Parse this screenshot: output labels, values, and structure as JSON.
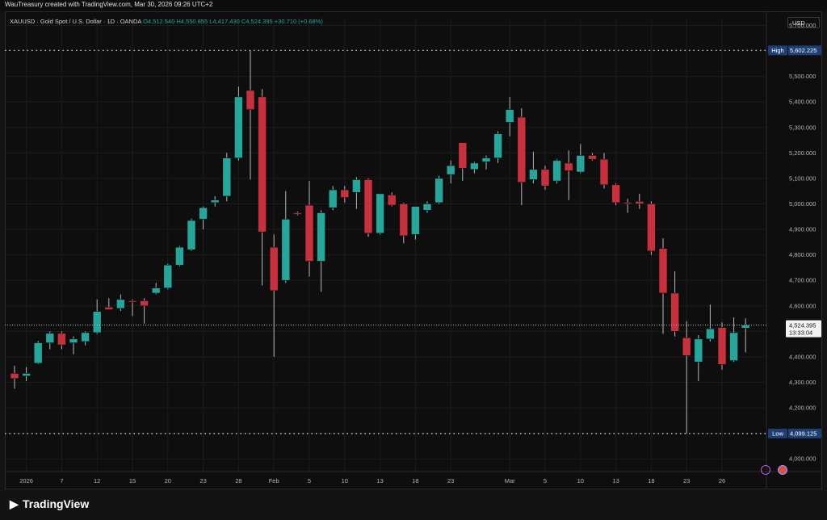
{
  "header": {
    "attribution": "WauTreasury created with TradingView.com, Mar 30, 2026 09:26 UTC+2"
  },
  "legend": {
    "symbol": "XAUUSD · Gold Spot / U.S. Dollar · 1D · OANDA",
    "open": "O4,512.540",
    "high": "H4,550.855",
    "low": "L4,417.430",
    "close": "C4,524.395",
    "change": "+30.710 (+0.68%)"
  },
  "currency_button": "USD",
  "footer": {
    "brand": "TradingView"
  },
  "colors": {
    "up": "#26a69a",
    "down": "#c8303e",
    "background": "#0e0e0e",
    "grid": "#1c1c1c"
  },
  "chart_data": {
    "type": "candlestick",
    "y_axis": {
      "min": 3950,
      "max": 5730,
      "ticks": [
        4000,
        4100,
        4200,
        4300,
        4400,
        4500,
        4600,
        4700,
        4800,
        4900,
        5000,
        5100,
        5200,
        5300,
        5400,
        5500,
        5700
      ],
      "tick_labels": [
        "4,000.000",
        "4,100.000",
        "4,200.000",
        "4,300.000",
        "4,400.000",
        "4,500.000",
        "4,600.000",
        "4,700.000",
        "4,800.000",
        "4,900.000",
        "5,000.000",
        "5,100.000",
        "5,200.000",
        "5,300.000",
        "5,400.000",
        "5,500.000",
        "5,700.000"
      ]
    },
    "x_tick_labels": [
      {
        "label": "2026",
        "index": 1
      },
      {
        "label": "7",
        "index": 4
      },
      {
        "label": "12",
        "index": 7
      },
      {
        "label": "15",
        "index": 10
      },
      {
        "label": "20",
        "index": 13
      },
      {
        "label": "23",
        "index": 16
      },
      {
        "label": "28",
        "index": 19
      },
      {
        "label": "Feb",
        "index": 22
      },
      {
        "label": "5",
        "index": 25
      },
      {
        "label": "10",
        "index": 28
      },
      {
        "label": "13",
        "index": 31
      },
      {
        "label": "18",
        "index": 34
      },
      {
        "label": "23",
        "index": 37
      },
      {
        "label": "Mar",
        "index": 42
      },
      {
        "label": "5",
        "index": 45
      },
      {
        "label": "10",
        "index": 48
      },
      {
        "label": "13",
        "index": 51
      },
      {
        "label": "18",
        "index": 54
      },
      {
        "label": "23",
        "index": 57
      },
      {
        "label": "26",
        "index": 60
      }
    ],
    "high_marker": {
      "label": "High",
      "value": 5602.225,
      "text": "5,602.225"
    },
    "low_marker": {
      "label": "Low",
      "value": 4099.125,
      "text": "4,099.125"
    },
    "last_price": {
      "value": 4524.395,
      "text": "4,524.395",
      "countdown": "13:33:04"
    },
    "candles": [
      {
        "o": 4335,
        "h": 4365,
        "l": 4275,
        "c": 4315
      },
      {
        "o": 4325,
        "h": 4360,
        "l": 4305,
        "c": 4335
      },
      {
        "o": 4375,
        "h": 4462,
        "l": 4372,
        "c": 4455
      },
      {
        "o": 4455,
        "h": 4500,
        "l": 4430,
        "c": 4492
      },
      {
        "o": 4492,
        "h": 4500,
        "l": 4430,
        "c": 4447
      },
      {
        "o": 4455,
        "h": 4480,
        "l": 4410,
        "c": 4470
      },
      {
        "o": 4460,
        "h": 4500,
        "l": 4445,
        "c": 4495
      },
      {
        "o": 4495,
        "h": 4625,
        "l": 4490,
        "c": 4578
      },
      {
        "o": 4595,
        "h": 4630,
        "l": 4585,
        "c": 4585
      },
      {
        "o": 4590,
        "h": 4645,
        "l": 4580,
        "c": 4625
      },
      {
        "o": 4620,
        "h": 4625,
        "l": 4560,
        "c": 4615
      },
      {
        "o": 4620,
        "h": 4630,
        "l": 4530,
        "c": 4600
      },
      {
        "o": 4650,
        "h": 4690,
        "l": 4645,
        "c": 4670
      },
      {
        "o": 4670,
        "h": 4765,
        "l": 4665,
        "c": 4760
      },
      {
        "o": 4760,
        "h": 4835,
        "l": 4755,
        "c": 4830
      },
      {
        "o": 4820,
        "h": 4942,
        "l": 4815,
        "c": 4935
      },
      {
        "o": 4940,
        "h": 4990,
        "l": 4900,
        "c": 4985
      },
      {
        "o": 5005,
        "h": 5030,
        "l": 4990,
        "c": 5015
      },
      {
        "o": 5030,
        "h": 5200,
        "l": 5010,
        "c": 5180
      },
      {
        "o": 5180,
        "h": 5460,
        "l": 5170,
        "c": 5420
      },
      {
        "o": 5445,
        "h": 5602,
        "l": 5095,
        "c": 5370
      },
      {
        "o": 5420,
        "h": 5450,
        "l": 4680,
        "c": 4890
      },
      {
        "o": 4830,
        "h": 4880,
        "l": 4400,
        "c": 4660
      },
      {
        "o": 4700,
        "h": 5050,
        "l": 4690,
        "c": 4940
      },
      {
        "o": 4965,
        "h": 4970,
        "l": 4955,
        "c": 4960
      },
      {
        "o": 4995,
        "h": 5090,
        "l": 4715,
        "c": 4775
      },
      {
        "o": 4775,
        "h": 4975,
        "l": 4655,
        "c": 4965
      },
      {
        "o": 4985,
        "h": 5070,
        "l": 4975,
        "c": 5055
      },
      {
        "o": 5055,
        "h": 5070,
        "l": 5005,
        "c": 5025
      },
      {
        "o": 5045,
        "h": 5105,
        "l": 4980,
        "c": 5095
      },
      {
        "o": 5095,
        "h": 5100,
        "l": 4870,
        "c": 4885
      },
      {
        "o": 4885,
        "h": 5040,
        "l": 4880,
        "c": 5040
      },
      {
        "o": 5035,
        "h": 5045,
        "l": 4990,
        "c": 4995
      },
      {
        "o": 5000,
        "h": 5005,
        "l": 4845,
        "c": 4875
      },
      {
        "o": 4880,
        "h": 4985,
        "l": 4860,
        "c": 4990
      },
      {
        "o": 4975,
        "h": 5010,
        "l": 4965,
        "c": 5000
      },
      {
        "o": 5005,
        "h": 5110,
        "l": 5000,
        "c": 5100
      },
      {
        "o": 5115,
        "h": 5170,
        "l": 5080,
        "c": 5150
      },
      {
        "o": 5240,
        "h": 5240,
        "l": 5090,
        "c": 5140
      },
      {
        "o": 5135,
        "h": 5165,
        "l": 5120,
        "c": 5160
      },
      {
        "o": 5165,
        "h": 5190,
        "l": 5135,
        "c": 5180
      },
      {
        "o": 5180,
        "h": 5285,
        "l": 5160,
        "c": 5275
      },
      {
        "o": 5320,
        "h": 5420,
        "l": 5265,
        "c": 5370
      },
      {
        "o": 5340,
        "h": 5375,
        "l": 4995,
        "c": 5085
      },
      {
        "o": 5095,
        "h": 5205,
        "l": 5080,
        "c": 5135
      },
      {
        "o": 5135,
        "h": 5150,
        "l": 5055,
        "c": 5070
      },
      {
        "o": 5090,
        "h": 5175,
        "l": 5080,
        "c": 5170
      },
      {
        "o": 5160,
        "h": 5210,
        "l": 5015,
        "c": 5130
      },
      {
        "o": 5125,
        "h": 5235,
        "l": 5120,
        "c": 5190
      },
      {
        "o": 5190,
        "h": 5200,
        "l": 5170,
        "c": 5175
      },
      {
        "o": 5175,
        "h": 5200,
        "l": 5060,
        "c": 5075
      },
      {
        "o": 5075,
        "h": 5080,
        "l": 4995,
        "c": 5005
      },
      {
        "o": 5005,
        "h": 5020,
        "l": 4965,
        "c": 5000
      },
      {
        "o": 5010,
        "h": 5040,
        "l": 4980,
        "c": 5000
      },
      {
        "o": 5000,
        "h": 5010,
        "l": 4800,
        "c": 4815
      },
      {
        "o": 4825,
        "h": 4865,
        "l": 4490,
        "c": 4650
      },
      {
        "o": 4650,
        "h": 4735,
        "l": 4480,
        "c": 4500
      },
      {
        "o": 4475,
        "h": 4540,
        "l": 4099,
        "c": 4405
      },
      {
        "o": 4380,
        "h": 4485,
        "l": 4305,
        "c": 4470
      },
      {
        "o": 4470,
        "h": 4605,
        "l": 4460,
        "c": 4510
      },
      {
        "o": 4515,
        "h": 4535,
        "l": 4350,
        "c": 4370
      },
      {
        "o": 4385,
        "h": 4555,
        "l": 4380,
        "c": 4495
      },
      {
        "o": 4512.54,
        "h": 4550.855,
        "l": 4417.43,
        "c": 4524.395
      }
    ]
  }
}
